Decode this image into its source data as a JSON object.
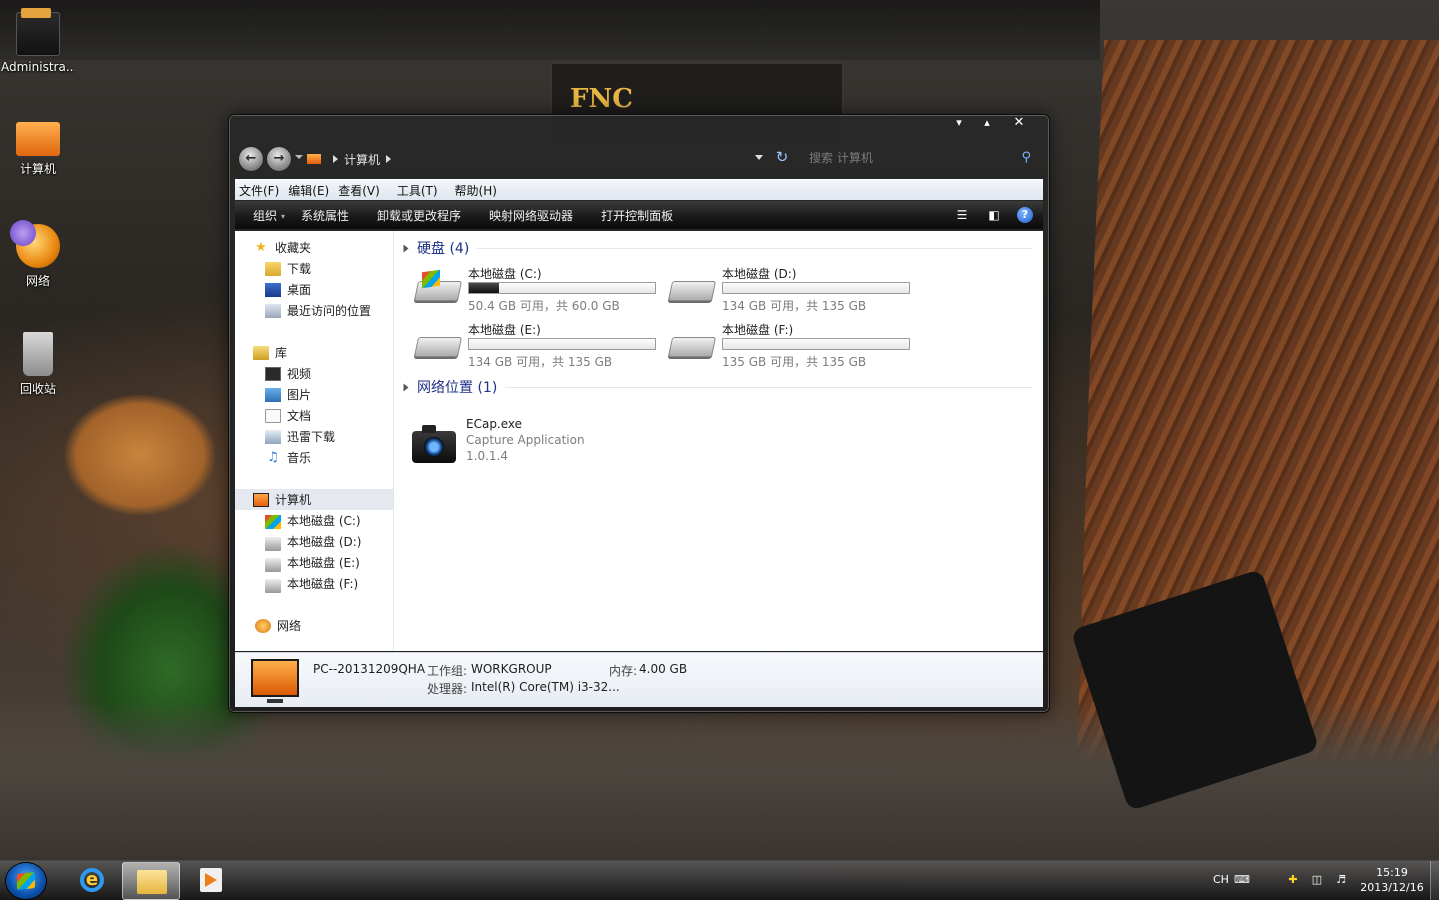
{
  "desktop": {
    "icons": [
      {
        "label": "Administra..."
      },
      {
        "label": "计算机"
      },
      {
        "label": "网络"
      },
      {
        "label": "回收站"
      }
    ],
    "wallpaper_sign": "FNC"
  },
  "window": {
    "caption": {
      "minimize": "▾",
      "maximize": "▴",
      "close": "✕"
    },
    "address": {
      "segment": "计算机"
    },
    "search": {
      "placeholder": "搜索 计算机"
    },
    "menu": [
      "文件(F)",
      "编辑(E)",
      "查看(V)",
      "工具(T)",
      "帮助(H)"
    ],
    "toolbar": [
      "组织",
      "系统属性",
      "卸载或更改程序",
      "映射网络驱动器",
      "打开控制面板"
    ],
    "navpane": {
      "favorites": {
        "label": "收藏夹",
        "items": [
          "下载",
          "桌面",
          "最近访问的位置"
        ]
      },
      "libraries": {
        "label": "库",
        "items": [
          "视频",
          "图片",
          "文档",
          "迅雷下载",
          "音乐"
        ]
      },
      "computer": {
        "label": "计算机",
        "items": [
          "本地磁盘 (C:)",
          "本地磁盘 (D:)",
          "本地磁盘 (E:)",
          "本地磁盘 (F:)"
        ]
      },
      "network": {
        "label": "网络"
      }
    },
    "groups": {
      "hard_disks": "硬盘 (4)",
      "network_locations": "网络位置 (1)"
    },
    "drives": [
      {
        "name": "本地磁盘 (C:)",
        "free": "50.4 GB 可用，共 60.0 GB",
        "used_fraction": 0.16,
        "system": true
      },
      {
        "name": "本地磁盘 (D:)",
        "free": "134 GB 可用，共 135 GB",
        "used_fraction": 0.0,
        "system": false
      },
      {
        "name": "本地磁盘 (E:)",
        "free": "134 GB 可用，共 135 GB",
        "used_fraction": 0.0,
        "system": false
      },
      {
        "name": "本地磁盘 (F:)",
        "free": "135 GB 可用，共 135 GB",
        "used_fraction": 0.0,
        "system": false
      }
    ],
    "network_item": {
      "name": "ECap.exe",
      "description": "Capture Application",
      "version": "1.0.1.4"
    },
    "details": {
      "pc_name": "PC--20131209QHA",
      "workgroup_label": "工作组:",
      "workgroup": "WORKGROUP",
      "memory_label": "内存:",
      "memory": "4.00 GB",
      "cpu_label": "处理器:",
      "cpu": "Intel(R) Core(TM) i3-32..."
    }
  },
  "taskbar": {
    "language": "CH",
    "time": "15:19",
    "date": "2013/12/16"
  }
}
